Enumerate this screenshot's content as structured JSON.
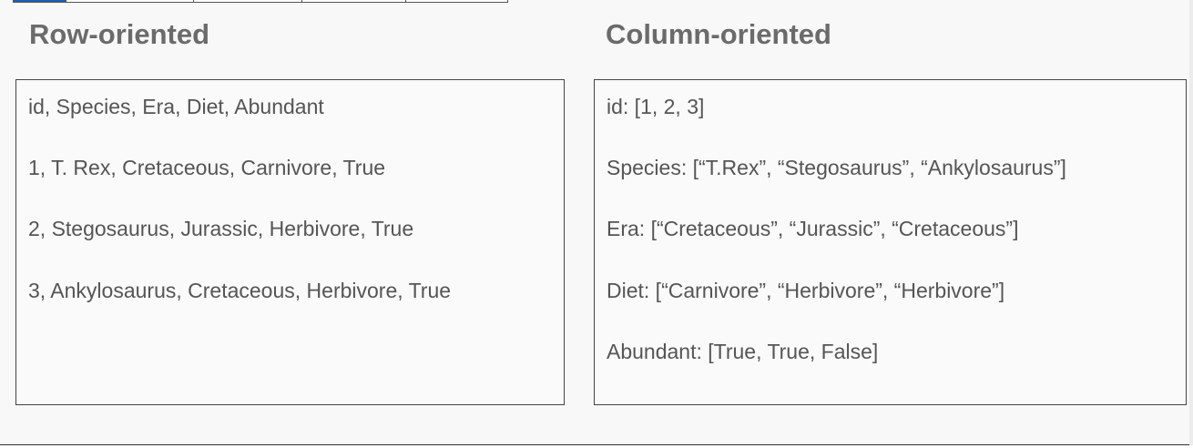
{
  "row_oriented": {
    "title": "Row-oriented",
    "lines": [
      "id, Species, Era, Diet, Abundant",
      "1, T. Rex, Cretaceous, Carnivore, True",
      "2, Stegosaurus, Jurassic, Herbivore, True",
      "3, Ankylosaurus, Cretaceous, Herbivore, True"
    ]
  },
  "column_oriented": {
    "title": "Column-oriented",
    "lines": [
      "id: [1, 2, 3]",
      "Species: [“T.Rex”, “Stegosaurus”, “Ankylosaurus”]",
      "Era: [“Cretaceous”, “Jurassic”, “Cretaceous”]",
      "Diet: [“Carnivore”, “Herbivore”, “Herbivore”]",
      "Abundant: [True, True, False]"
    ]
  },
  "colors": {
    "heading": "#6b6b6b",
    "text": "#555555",
    "border": "#444444",
    "background": "#f8f8f8",
    "active_tab": "#4a8fd8"
  }
}
